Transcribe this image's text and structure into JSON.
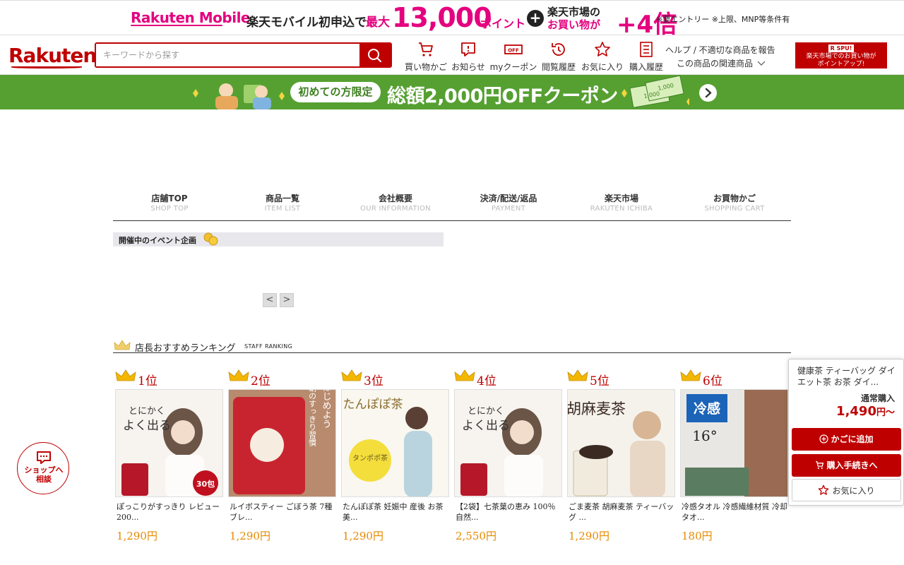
{
  "promo": {
    "brand": "Rakuten Mobile",
    "text1": "楽天モバイル初申込で",
    "text2": "最大",
    "amount": "13,000",
    "points": "ポイント",
    "plus": "+",
    "text3a": "楽天市場の",
    "text3b": "お買い物が",
    "multiplier": "+4倍",
    "note": "※要エントリー ※上限、MNP等条件有"
  },
  "header": {
    "logo": "Rakuten",
    "search_placeholder": "キーワードから探す",
    "nav": [
      {
        "label": "買い物かご",
        "icon": "cart-icon"
      },
      {
        "label": "お知らせ",
        "icon": "notice-icon"
      },
      {
        "label": "myクーポン",
        "icon": "coupon-icon"
      },
      {
        "label": "閲覧履歴",
        "icon": "history-icon"
      },
      {
        "label": "お気に入り",
        "icon": "star-icon"
      },
      {
        "label": "購入履歴",
        "icon": "list-icon"
      }
    ],
    "help_link": "ヘルプ / 不適切な商品を報告",
    "related_link": "この商品の関連商品",
    "spu": {
      "tag": "R SPU!",
      "line1": "楽天市場でのお買い物が",
      "line2": "ポイントアップ!"
    }
  },
  "coupon_banner": {
    "pill": "初めての方限定",
    "text": "総額2,000円OFFクーポン",
    "ticket1": "1,000",
    "ticket2": "1,000"
  },
  "shop_nav": [
    {
      "jp": "店舗TOP",
      "en": "SHOP TOP"
    },
    {
      "jp": "商品一覧",
      "en": "ITEM LIST"
    },
    {
      "jp": "会社概要",
      "en": "OUR INFORMATION"
    },
    {
      "jp": "決済/配送/返品",
      "en": "PAYMENT"
    },
    {
      "jp": "楽天市場",
      "en": "RAKUTEN ICHIBA"
    },
    {
      "jp": "お買物かご",
      "en": "SHOPPING CART"
    }
  ],
  "event": {
    "title": "開催中のイベント企画",
    "prev": "<",
    "next": ">"
  },
  "ranking": {
    "title": "店長おすすめランキング",
    "title_en": "STAFF RANKING",
    "items": [
      {
        "rank": "1位",
        "name": "ぽっこりがすっきり レビュー200...",
        "price": "1,290円",
        "img_text": "とにかく\nよく出る",
        "badge": "30包"
      },
      {
        "rank": "2位",
        "name": "ルイボスティー ごぼう茶 7種 ブレ...",
        "price": "1,290円",
        "img_text": "はじめよう\n朝のすっきり習慣",
        "badge": ""
      },
      {
        "rank": "3位",
        "name": "たんぽぽ茶 妊娠中 産後 お茶 美...",
        "price": "1,290円",
        "img_text": "たんぽぽ茶",
        "badge": ""
      },
      {
        "rank": "4位",
        "name": "【2袋】七茶葉の恵み 100％自然...",
        "price": "2,550円",
        "img_text": "とにかく\nよく出る",
        "badge": ""
      },
      {
        "rank": "5位",
        "name": "ごま麦茶 胡麻麦茶 ティーバッグ ...",
        "price": "1,290円",
        "img_text": "胡麻麦茶",
        "badge": ""
      },
      {
        "rank": "6位",
        "name": "冷感タオル 冷感繊維材質 冷却タオ...",
        "price": "180円",
        "img_text": "冷感",
        "badge": "16°"
      }
    ]
  },
  "float_panel": {
    "product_name": "健康茶 ティーバッグ ダイエット茶 お茶 ダイ...",
    "purchase_type": "通常購入",
    "price": "1,490",
    "price_suffix": "円〜",
    "add_cart": "かごに追加",
    "checkout": "購入手続きへ",
    "favorite": "お気に入り"
  },
  "chat": {
    "line1": "ショップへ",
    "line2": "相談"
  }
}
